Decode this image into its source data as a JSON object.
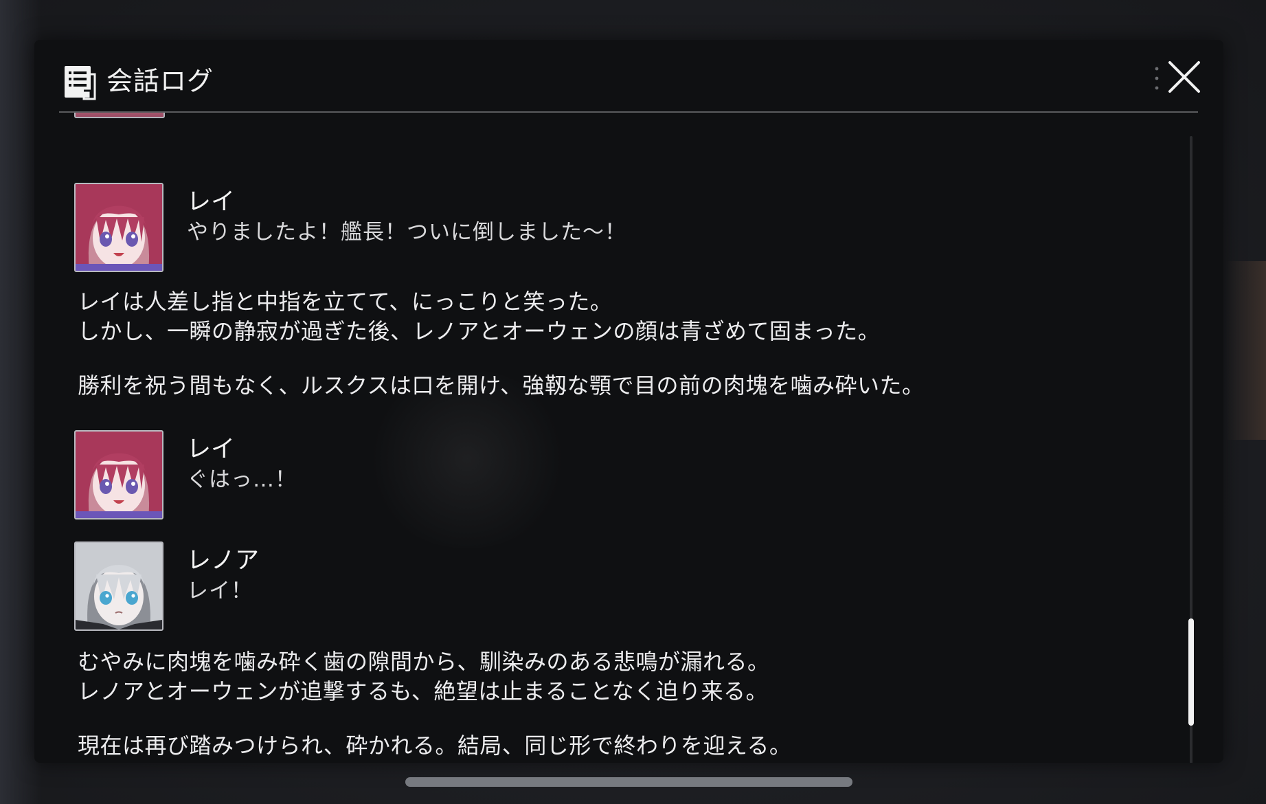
{
  "header": {
    "title": "会話ログ"
  },
  "entries": [
    {
      "kind": "dialogue",
      "speaker": "レイ",
      "text": "やりましたよ！艦長！ついに倒しました〜！",
      "portrait": "rei"
    },
    {
      "kind": "narration",
      "lines": [
        "レイは人差し指と中指を立てて、にっこりと笑った。",
        "しかし、一瞬の静寂が過ぎた後、レノアとオーウェンの顔は青ざめて固まった。"
      ]
    },
    {
      "kind": "narration",
      "lines": [
        "勝利を祝う間もなく、ルスクスは口を開け、強靱な顎で目の前の肉塊を噛み砕いた。"
      ]
    },
    {
      "kind": "dialogue",
      "speaker": "レイ",
      "text": "ぐはっ…！",
      "portrait": "rei"
    },
    {
      "kind": "dialogue",
      "speaker": "レノア",
      "text": "レイ！",
      "portrait": "lenoa"
    },
    {
      "kind": "narration",
      "lines": [
        "むやみに肉塊を噛み砕く歯の隙間から、馴染みのある悲鳴が漏れる。",
        "レノアとオーウェンが追撃するも、絶望は止まることなく迫り来る。"
      ]
    },
    {
      "kind": "narration",
      "lines": [
        "現在は再び踏みつけられ、砕かれる。結局、同じ形で終わりを迎える。"
      ]
    }
  ],
  "icons": {
    "header": "log-document-icon",
    "close": "close-icon",
    "menu": "vertical-dots-icon"
  },
  "colors": {
    "panel_bg": "#0f1012",
    "text": "#ececee",
    "portrait_rei_hair": "#b23a5c",
    "portrait_lenoa_hair": "#cfd2d6"
  }
}
